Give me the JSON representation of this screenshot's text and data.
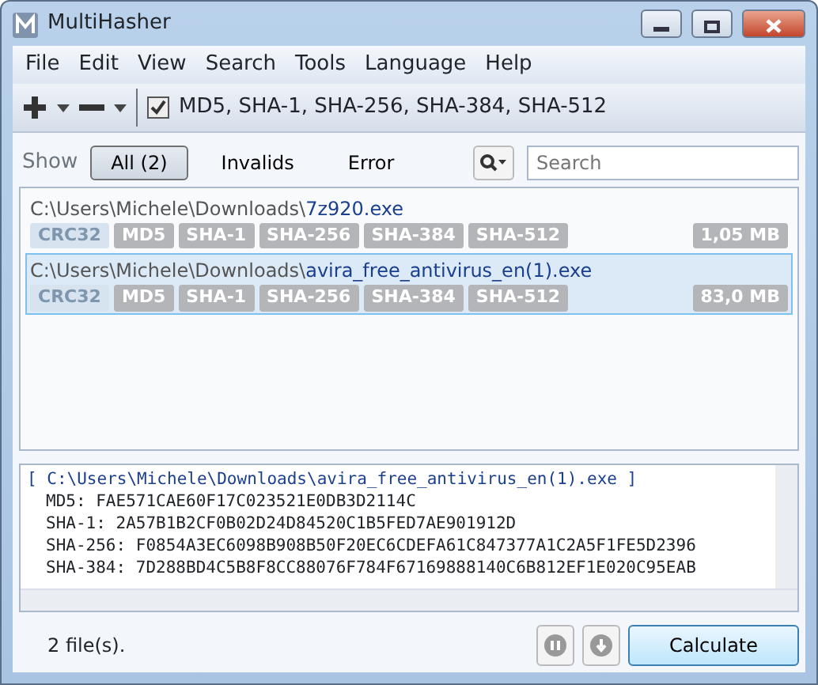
{
  "window": {
    "title": "MultiHasher"
  },
  "menu": [
    "File",
    "Edit",
    "View",
    "Search",
    "Tools",
    "Language",
    "Help"
  ],
  "toolbar": {
    "algorithms_checked": true,
    "algorithms": "MD5, SHA-1, SHA-256, SHA-384, SHA-512"
  },
  "filter": {
    "label": "Show",
    "options": [
      {
        "label": "All (2)",
        "selected": true
      },
      {
        "label": "Invalids",
        "selected": false
      },
      {
        "label": "Error",
        "selected": false
      }
    ],
    "search": {
      "placeholder": "Search"
    }
  },
  "files": [
    {
      "path": "C:\\Users\\Michele\\Downloads\\",
      "name": "7z920.exe",
      "selected": false,
      "size": "1,05 MB",
      "tags": [
        {
          "label": "CRC32",
          "enabled": false
        },
        {
          "label": "MD5",
          "enabled": true
        },
        {
          "label": "SHA-1",
          "enabled": true
        },
        {
          "label": "SHA-256",
          "enabled": true
        },
        {
          "label": "SHA-384",
          "enabled": true
        },
        {
          "label": "SHA-512",
          "enabled": true
        }
      ]
    },
    {
      "path": "C:\\Users\\Michele\\Downloads\\",
      "name": "avira_free_antivirus_en(1).exe",
      "selected": true,
      "size": "83,0 MB",
      "tags": [
        {
          "label": "CRC32",
          "enabled": false
        },
        {
          "label": "MD5",
          "enabled": true
        },
        {
          "label": "SHA-1",
          "enabled": true
        },
        {
          "label": "SHA-256",
          "enabled": true
        },
        {
          "label": "SHA-384",
          "enabled": true
        },
        {
          "label": "SHA-512",
          "enabled": true
        }
      ]
    }
  ],
  "output": {
    "header": "[ C:\\Users\\Michele\\Downloads\\avira_free_antivirus_en(1).exe ]",
    "lines": [
      "MD5: FAE571CAE60F17C023521E0DB3D2114C",
      "SHA-1: 2A57B1B2CF0B02D24D84520C1B5FED7AE901912D",
      "SHA-256: F0854A3EC6098B908B50F20EC6CDEFA61C847377A1C2A5F1FE5D2396",
      "SHA-384: 7D288BD4C5B8F8CC88076F784F67169888140C6B812EF1E020C95EAB"
    ]
  },
  "status_bar": {
    "text": "2 file(s).",
    "calculate": "Calculate"
  }
}
